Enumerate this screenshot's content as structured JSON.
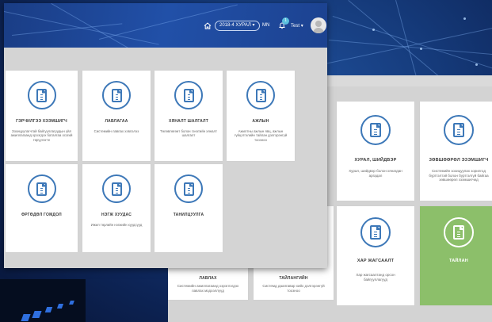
{
  "header": {
    "season_label": "2018-4 ХУРАЛ",
    "language": "MN",
    "notification_count": "1",
    "username": "Test"
  },
  "front_cards": [
    {
      "title": "ГЭРЧИЛГЭЭ ХЭЭМШИГЧ",
      "desc": "Зохицуулагчтай байгууллагуудын үйл ажиллагаанд хроэгдэх баталгаа осзгий төрүүлэгте"
    },
    {
      "title": "ЛАВЛАГАА",
      "desc": "Системийн лавлах хэвлэлээ"
    },
    {
      "title": "ХЯНАЛТ ШАЛГАЛТ",
      "desc": "Төлөвлөгөөт болон гэнэтийн хяналт шалгалт"
    },
    {
      "title": "АЖЛЫН",
      "desc": "Ажилтны ажлын явц, ажлын гүйцэтгэлийн тайлан дэлгэрэнгүй тоозноо"
    },
    {
      "title": "ӨРГӨДӨЛ ГОМДОЛ",
      "desc": ""
    },
    {
      "title": "НЭГЖ ХУУДАС",
      "desc": "Ижил төрлийн нэгжийн хуудсууд"
    },
    {
      "title": "ТАНИЛЦУУЛГА",
      "desc": ""
    }
  ],
  "back_cards": [
    {
      "title": "ХУРАЛ, ШИЙДВЭР",
      "desc": "Хурал, шийдвэр болон хянагдан аргадал"
    },
    {
      "title": "ЗӨВШӨӨРӨЛ ЭЗЭМШИГЧ",
      "desc": "Системийн зохицуулах зорилгод бүртгэлтэй болон бүртгэлгүй байгаа зөвшөөрөл эзэмшигчид"
    },
    {
      "title": "ХАР ЖАГСААЛТ",
      "desc": "Хар жагсаалтанд орсон байгууллагууд"
    },
    {
      "title": "ТАЙЛАН",
      "desc": ""
    }
  ],
  "back_partial": [
    {
      "title": "ЛАВЛАХ",
      "desc": "Системийн ажиллагаанд хэрэглэгдэх лавлах мэдээллүүд"
    },
    {
      "title": "ТАЙЛАНГИЙН",
      "desc": "Системд даалгавар хийх дэлгэрэнгүй тоозноо"
    }
  ],
  "colors": {
    "accent_blue": "#3d78b8",
    "report_green": "#8cbf6a",
    "header_blue": "#2150a8"
  }
}
